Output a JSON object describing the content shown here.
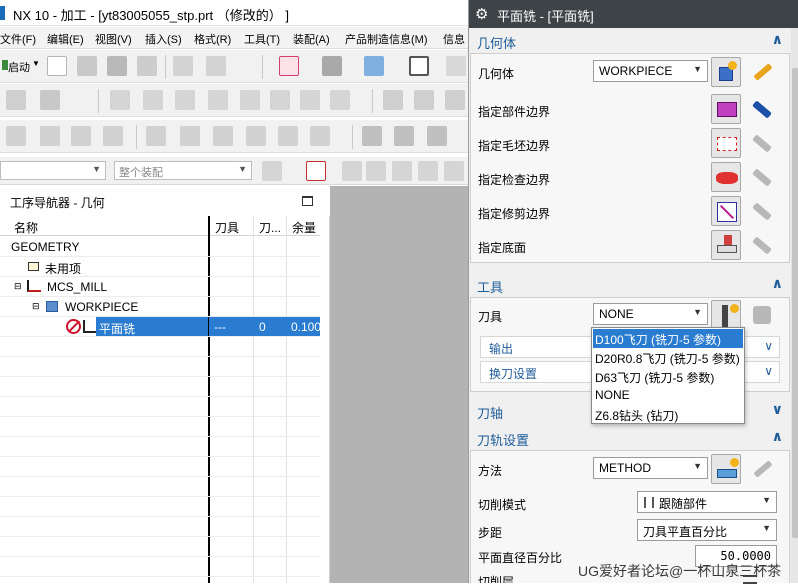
{
  "window": {
    "title": "NX 10 - 加工 - [yt83005055_stp.prt （修改的） ]"
  },
  "menu": [
    "文件(F)",
    "编辑(E)",
    "视图(V)",
    "插入(S)",
    "格式(R)",
    "工具(T)",
    "装配(A)",
    "产品制造信息(M)",
    "信息"
  ],
  "toolbar": {
    "start_label": "启动",
    "assembly_combo": "整个装配"
  },
  "navigator": {
    "title": "工序导航器 - 几何",
    "columns": [
      "名称",
      "刀具",
      "刀...",
      "余量"
    ],
    "rows": [
      {
        "name": "GEOMETRY",
        "tool": "",
        "t2": "",
        "stock": ""
      },
      {
        "name": "未用项",
        "tool": "",
        "t2": "",
        "stock": ""
      },
      {
        "name": "MCS_MILL",
        "tool": "",
        "t2": "",
        "stock": ""
      },
      {
        "name": "WORKPIECE",
        "tool": "",
        "t2": "",
        "stock": ""
      },
      {
        "name": "平面铣",
        "tool": "---",
        "t2": "0",
        "stock": "0.100"
      }
    ]
  },
  "dialog": {
    "title": "平面铣 - [平面铣]",
    "geometry": {
      "header": "几何体",
      "label": "几何体",
      "value": "WORKPIECE",
      "items": [
        "指定部件边界",
        "指定毛坯边界",
        "指定检查边界",
        "指定修剪边界",
        "指定底面"
      ]
    },
    "tool": {
      "header": "工具",
      "label": "刀具",
      "value": "NONE",
      "output": "输出",
      "change": "换刀设置",
      "options": [
        "D100飞刀 (铣刀-5 参数)",
        "D20R0.8飞刀 (铣刀-5 参数)",
        "D63飞刀 (铣刀-5 参数)",
        "NONE",
        "Z6.8钻头 (钻刀)"
      ]
    },
    "axis": {
      "header": "刀轴"
    },
    "path": {
      "header": "刀轨设置",
      "method_label": "方法",
      "method_value": "METHOD",
      "cut_label": "切削模式",
      "cut_value": "跟随部件",
      "step_label": "步距",
      "step_value": "刀具平直百分比",
      "pct_label": "平面直径百分比",
      "pct_value": "50.0000",
      "cutlevel_label": "切削层"
    }
  },
  "watermark": "UG爱好者论坛@一杯山泉三杯茶"
}
